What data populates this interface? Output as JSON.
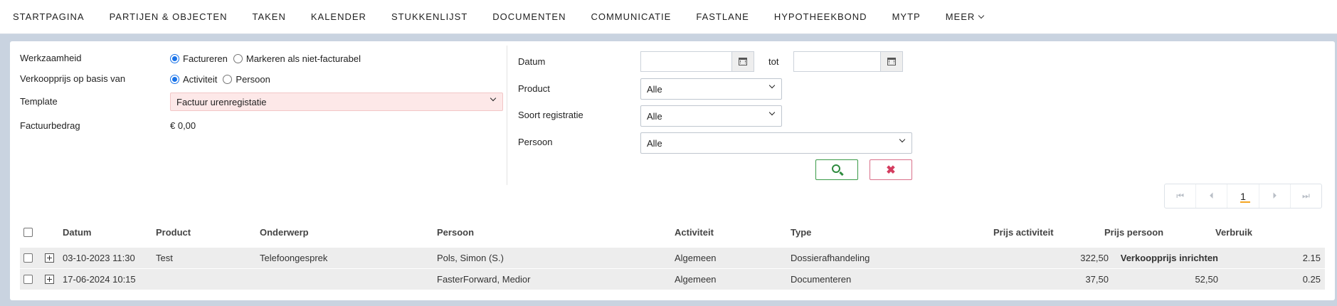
{
  "nav": {
    "items": [
      "STARTPAGINA",
      "PARTIJEN & OBJECTEN",
      "TAKEN",
      "KALENDER",
      "STUKKENLIJST",
      "DOCUMENTEN",
      "COMMUNICATIE",
      "FASTLANE",
      "HYPOTHEEKBOND",
      "MYTP",
      "MEER"
    ]
  },
  "form": {
    "werkzaamheid_label": "Werkzaamheid",
    "werkzaamheid_opt1": "Factureren",
    "werkzaamheid_opt2": "Markeren als niet-facturabel",
    "verkoopprijs_label": "Verkoopprijs op basis van",
    "verkoopprijs_opt1": "Activiteit",
    "verkoopprijs_opt2": "Persoon",
    "template_label": "Template",
    "template_value": "Factuur urenregistatie",
    "factuurbedrag_label": "Factuurbedrag",
    "factuurbedrag_value": "€ 0,00"
  },
  "filters": {
    "datum_label": "Datum",
    "tot_label": "tot",
    "product_label": "Product",
    "product_value": "Alle",
    "soort_label": "Soort registratie",
    "soort_value": "Alle",
    "persoon_label": "Persoon",
    "persoon_value": "Alle",
    "clear_glyph": "✖"
  },
  "pager": {
    "current_page": "1"
  },
  "table": {
    "headers": {
      "datum": "Datum",
      "product": "Product",
      "onderwerp": "Onderwerp",
      "persoon": "Persoon",
      "activiteit": "Activiteit",
      "type": "Type",
      "prijs_activiteit": "Prijs activiteit",
      "prijs_persoon": "Prijs persoon",
      "verbruik": "Verbruik"
    },
    "rows": [
      {
        "datum": "03-10-2023 11:30",
        "product": "Test",
        "onderwerp": "Telefoongesprek",
        "persoon": "Pols, Simon (S.)",
        "activiteit": "Algemeen",
        "type": "Dossierafhandeling",
        "prijs_activiteit": "322,50",
        "prijs_persoon": "Verkoopprijs inrichten",
        "verbruik": "2.15"
      },
      {
        "datum": "17-06-2024 10:15",
        "product": "",
        "onderwerp": "",
        "persoon": "FasterForward, Medior",
        "activiteit": "Algemeen",
        "type": "Documenteren",
        "prijs_activiteit": "37,50",
        "prijs_persoon": "52,50",
        "verbruik": "0.25"
      }
    ]
  },
  "colors": {
    "accent": "#1a73e8",
    "search_green": "#2e8b3e",
    "clear_red": "#d43c5f",
    "template_bg": "#fde8e8",
    "row_bg": "#ededed",
    "page_bg": "#c9d3e0"
  }
}
